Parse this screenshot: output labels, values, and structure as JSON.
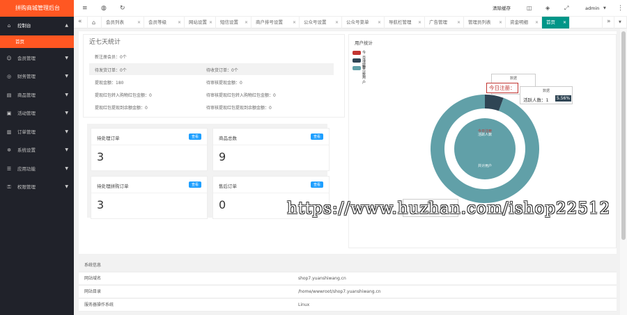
{
  "app": {
    "title": "拼购商城管理后台"
  },
  "sidebar": {
    "items": [
      {
        "label": "控制台",
        "icon": "home-icon",
        "open": true
      },
      {
        "label": "会员管理",
        "icon": "user-icon"
      },
      {
        "label": "财务管理",
        "icon": "money-icon"
      },
      {
        "label": "商品管理",
        "icon": "goods-icon"
      },
      {
        "label": "活动管理",
        "icon": "activity-icon"
      },
      {
        "label": "订单管理",
        "icon": "order-icon"
      },
      {
        "label": "系统设置",
        "icon": "gear-icon"
      },
      {
        "label": "应用功能",
        "icon": "app-icon"
      },
      {
        "label": "权限管理",
        "icon": "lock-icon"
      }
    ],
    "sub_active": "首页"
  },
  "topbar": {
    "clear_cache": "清除缓存",
    "user": "admin"
  },
  "tabs": [
    "会员列表",
    "会员等级",
    "网站设置",
    "短信设置",
    "商户排号设置",
    "公众号设置",
    "公众号菜单",
    "导航栏管理",
    "广告管理",
    "管理员列表",
    "资金明细",
    "首页"
  ],
  "stats": {
    "title": "近七天统计",
    "rows": [
      {
        "left": "新注册会员：0个",
        "right": ""
      },
      {
        "left": "待发货订单：0个",
        "right": "待收货订单：0个"
      },
      {
        "left": "提现金额：180",
        "right": "待审核提现金额：0"
      },
      {
        "left": "提现红包转入购物红包金额：0",
        "right": "待审核提现红包转入购物红包金额：0"
      },
      {
        "left": "提现红包提现到余额金额：0",
        "right": "待审核提现红包提现到余额金额：0"
      }
    ]
  },
  "cards": [
    {
      "title": "待处理订单",
      "badge": "查看",
      "value": "3"
    },
    {
      "title": "商品总数",
      "badge": "查看",
      "value": "9"
    },
    {
      "title": "待处理拼购订单",
      "badge": "查看",
      "value": "3"
    },
    {
      "title": "售后订单",
      "badge": "查看",
      "value": "0"
    }
  ],
  "chart_data": {
    "type": "pie",
    "title": "用户统计",
    "legend": [
      "今日注册",
      "活跃人数",
      "共计用户"
    ],
    "legend_position": "top-left",
    "colors": [
      "#c23531",
      "#2f4554",
      "#61a0a8"
    ],
    "outer_ring": [
      {
        "name": "今日注册",
        "value": 0
      },
      {
        "name": "活跃人数",
        "value": 5.56
      },
      {
        "name": "共计用户",
        "value": 94.44
      }
    ],
    "inner_labels": [
      "今日注册",
      "活跃人数",
      "共计用户"
    ],
    "tooltips": [
      {
        "header": "数据",
        "text": "今日注册："
      },
      {
        "header": "数据",
        "text": "活跃人数：1",
        "pct": "5.56%"
      },
      {
        "header": "数据",
        "text": ""
      }
    ]
  },
  "system": {
    "header": "系统信息",
    "rows": [
      {
        "label": "网站域名",
        "value": "shop7.yuanshiwang.cn"
      },
      {
        "label": "网站目录",
        "value": "/home/wwwroot/shop7.yuanshiwang.cn"
      },
      {
        "label": "服务器操作系统",
        "value": "Linux"
      }
    ]
  },
  "watermark": "https://www.huzhan.com/ishop22512"
}
